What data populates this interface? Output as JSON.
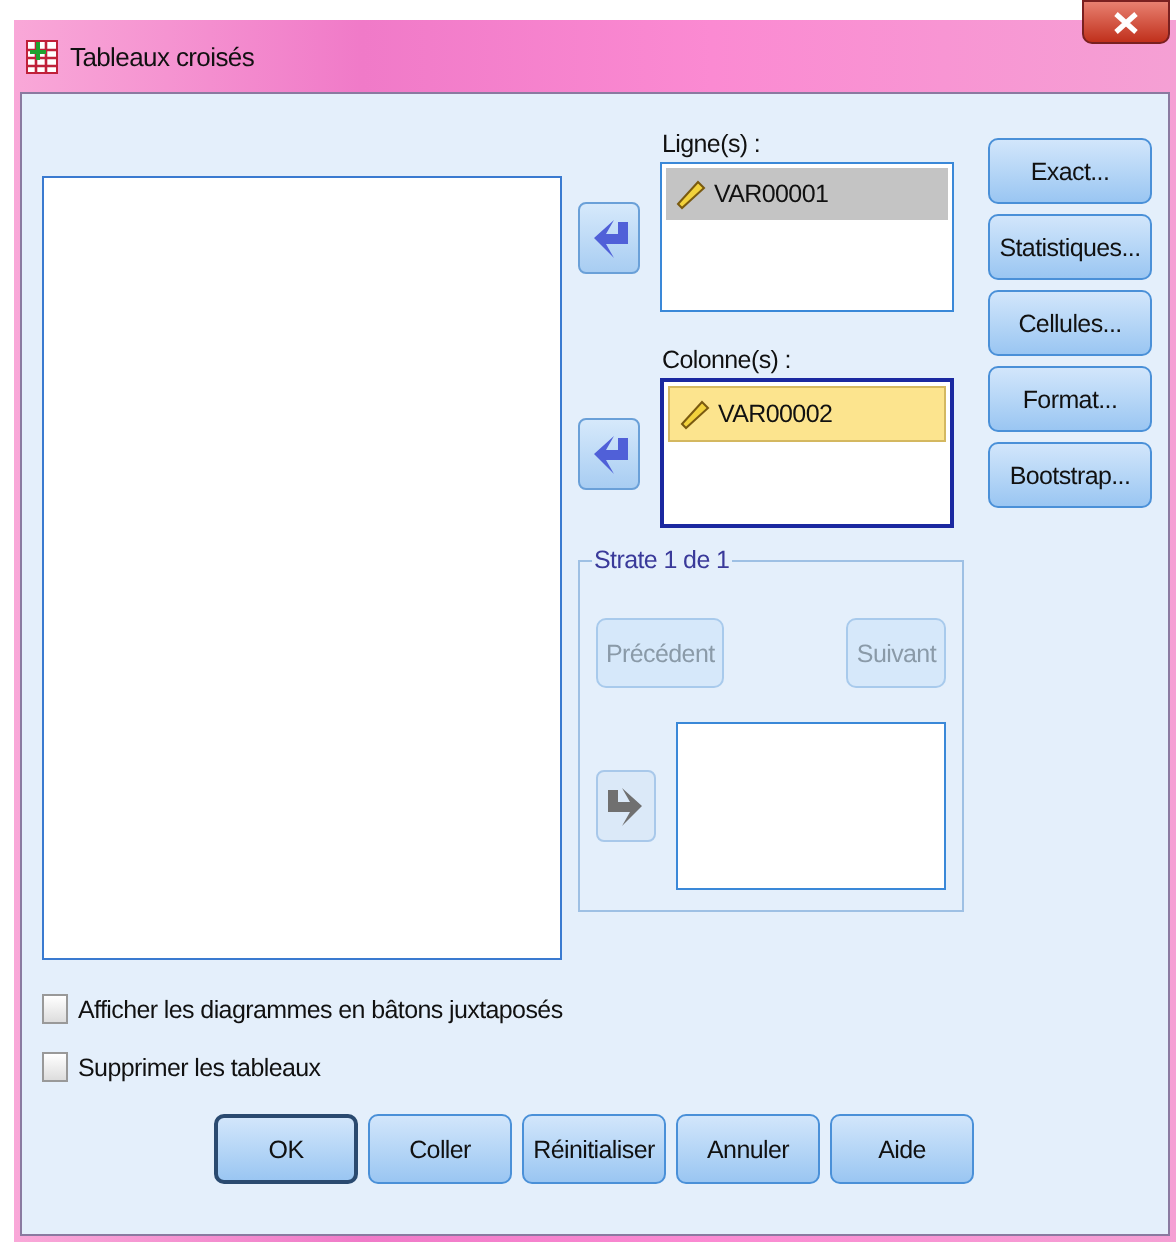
{
  "window": {
    "title": "Tableaux croisés"
  },
  "targets": [
    {
      "label": "Ligne(s) :",
      "focused": false,
      "arrow": {
        "kind": "left",
        "disabled": false
      },
      "items": [
        {
          "name": "VAR00001",
          "selected": true
        }
      ]
    },
    {
      "label": "Colonne(s) :",
      "focused": true,
      "arrow": {
        "kind": "left",
        "disabled": false
      },
      "items": [
        {
          "name": "VAR00002",
          "selected": true
        }
      ]
    }
  ],
  "side_buttons": [
    "Exact...",
    "Statistiques...",
    "Cellules...",
    "Format...",
    "Bootstrap..."
  ],
  "strata": {
    "legend": "Strate 1 de 1",
    "buttons": [
      {
        "label": "Précédent",
        "disabled": true
      },
      {
        "label": "Suivant",
        "disabled": true
      }
    ],
    "arrow": {
      "kind": "right",
      "disabled": true
    }
  },
  "checkboxes": [
    {
      "label": "Afficher les diagrammes en bâtons juxtaposés",
      "checked": false
    },
    {
      "label": "Supprimer les tableaux",
      "checked": false
    }
  ],
  "buttons": [
    {
      "label": "OK",
      "default": true
    },
    {
      "label": "Coller",
      "default": false
    },
    {
      "label": "Réinitialiser",
      "default": false
    },
    {
      "label": "Annuler",
      "default": false
    },
    {
      "label": "Aide",
      "default": false
    }
  ]
}
